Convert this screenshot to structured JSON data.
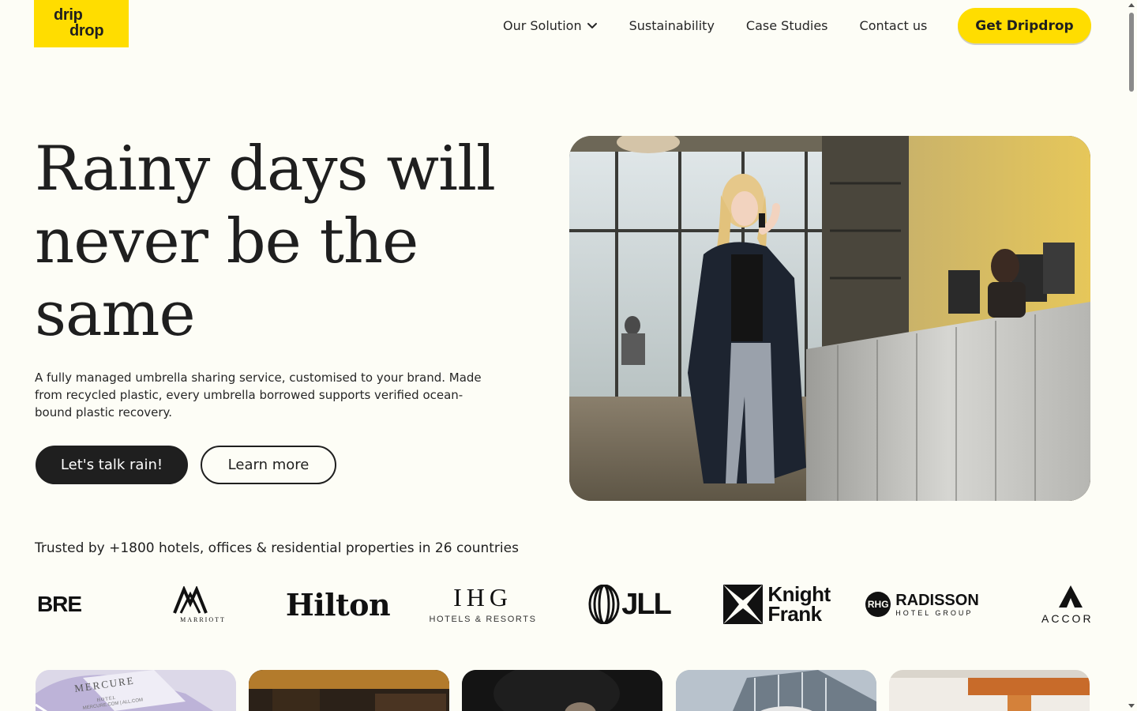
{
  "header": {
    "logo": {
      "line1": "drip",
      "line2": "drop"
    },
    "nav": [
      {
        "label": "Our Solution"
      },
      {
        "label": "Sustainability"
      },
      {
        "label": "Case Studies"
      },
      {
        "label": "Contact us"
      }
    ],
    "cta_label": "Get Dripdrop"
  },
  "hero": {
    "title_lines": [
      "Rainy days will",
      "never be the",
      "same"
    ],
    "description": "A fully managed umbrella sharing service, customised to your brand. Made from recycled plastic, every umbrella borrowed supports verified ocean-bound plastic recovery.",
    "primary_button": "Let's talk rain!",
    "secondary_button": "Learn more"
  },
  "trusted": {
    "heading": "Trusted by +1800 hotels, offices & residential properties in 26 countries",
    "brands": {
      "cbre": "BRE",
      "marriott": "MARRIOTT",
      "hilton": "Hilton",
      "ihg_main": "IHG",
      "ihg_sub": "HOTELS & RESORTS",
      "jll": "JLL",
      "knight_frank_1": "Knight",
      "knight_frank_2": "Frank",
      "radisson_badge": "RHG",
      "radisson_main": "RADISSON",
      "radisson_sub": "HOTEL GROUP",
      "accor": "ACCOR"
    }
  },
  "cards": {
    "mercure_1": "MERCURE",
    "mercure_2": "HOTEL",
    "mercure_3": "MERCURE.COM | ALL.COM"
  },
  "colors": {
    "background": "#fdfdf6",
    "brand_yellow": "#ffdd00",
    "text_dark": "#1f1f1f"
  }
}
